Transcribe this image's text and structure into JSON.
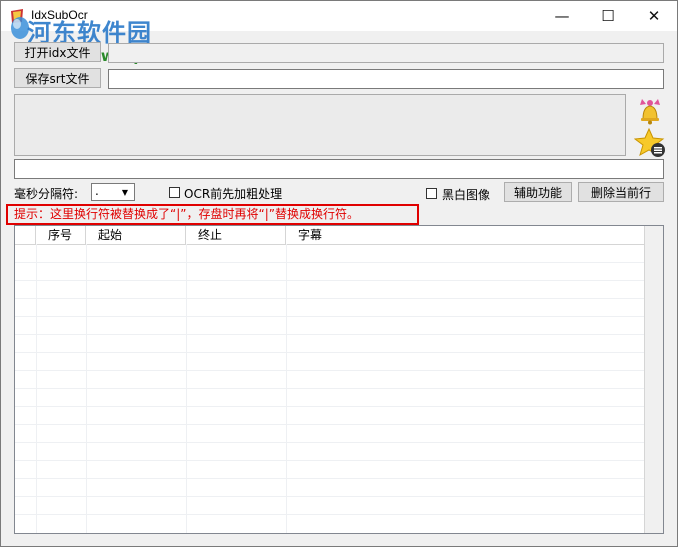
{
  "window": {
    "title": "IdxSubOcr",
    "watermark_name": "河东软件园",
    "watermark_url": "www.pc0359.cn",
    "minimize_glyph": "—",
    "maximize_glyph": "☐",
    "close_glyph": "✕"
  },
  "toolbar": {
    "open_idx_label": "打开idx文件",
    "save_srt_label": "保存srt文件",
    "idx_path_value": "",
    "srt_path_value": "",
    "ocr_text_value": ""
  },
  "icons": {
    "bell": "bell-icon",
    "star": "star-list-icon"
  },
  "options": {
    "ms_separator_label": "毫秒分隔符:",
    "ms_separator_value": ".",
    "ocr_bold_label": "OCR前先加粗处理",
    "ocr_bold_checked": false,
    "bw_image_label": "黑白图像",
    "bw_image_checked": false,
    "assist_button": "辅助功能",
    "delete_row_button": "删除当前行"
  },
  "hint": {
    "text": "提示：这里换行符被替换成了“|”，存盘时再将“|”替换成换行符。"
  },
  "table": {
    "columns": [
      "",
      "序号",
      "起始",
      "终止",
      "字幕"
    ],
    "rows": []
  },
  "colors": {
    "hint_red": "#e00000",
    "watermark_blue": "#2a79c9",
    "watermark_green": "#2a8a2a"
  }
}
